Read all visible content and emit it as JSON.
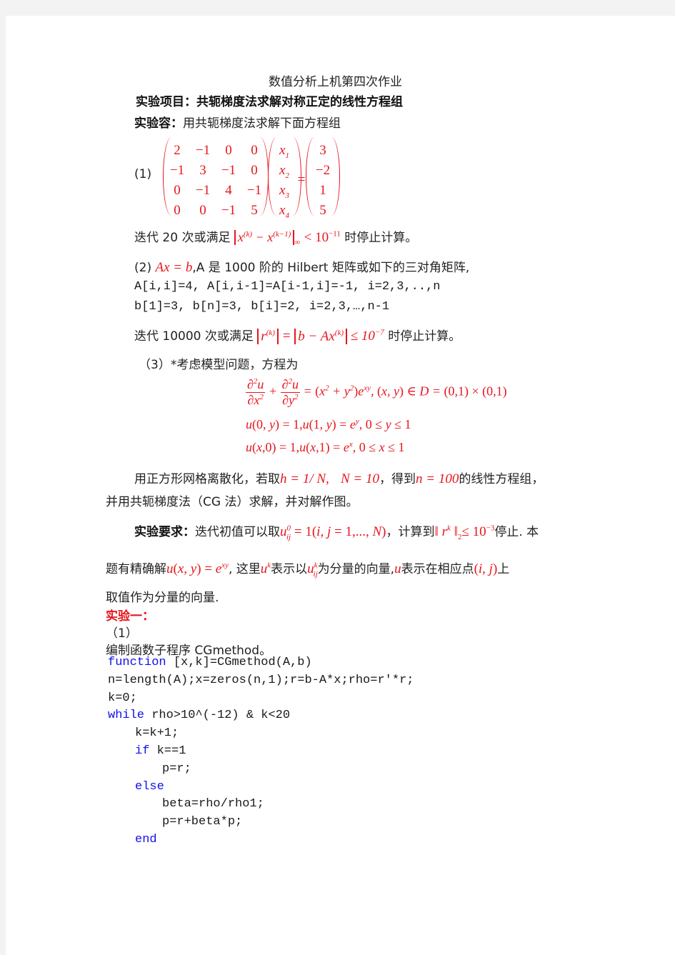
{
  "title": "数值分析上机第四次作业",
  "project": {
    "label": "实验项目：",
    "text": "共轭梯度法求解对称正定的线性方程组"
  },
  "content": {
    "label": "实验容：",
    "text": "用共轭梯度法求解下面方程组"
  },
  "problem1": {
    "label": "(1)",
    "matrix": [
      [
        "2",
        "−1",
        "0",
        "0"
      ],
      [
        "−1",
        "3",
        "−1",
        "0"
      ],
      [
        "0",
        "−1",
        "4",
        "−1"
      ],
      [
        "0",
        "0",
        "−1",
        "5"
      ]
    ],
    "x_vector": [
      "x1",
      "x2",
      "x3",
      "x4"
    ],
    "rhs": [
      "3",
      "−2",
      "1",
      "5"
    ],
    "equals": "=",
    "stop_prefix": "迭代 20 次或满足",
    "stop_norm": "x(k) − x(k−1)",
    "stop_norm_sub": "∞",
    "stop_cond": "< 10",
    "stop_exp": "−11",
    "stop_suffix": "时停止计算。"
  },
  "problem2": {
    "label": "(2)",
    "eq": "Ax = b",
    "desc": ",A 是 1000 阶的 Hilbert 矩阵或如下的三对角矩阵,",
    "line_a": "A[i,i]=4, A[i,i-1]=A[i-1,i]=-1, i=2,3,..,n",
    "line_b": "b[1]=3, b[n]=3, b[i]=2, i=2,3,…,n-1",
    "stop_prefix": "迭代 10000 次或满足",
    "stop_math": "‖r(k)‖ = ‖b − Ax(k)‖ ≤ 10",
    "stop_exp": "−7",
    "stop_suffix": "时停止计算。"
  },
  "problem3": {
    "label": "（3）*考虑模型问题，方程为",
    "pde": "∂²u/∂x² + ∂²u/∂y² = (x² + y²)e^xy , (x, y) ∈ D = (0,1) × (0,1)",
    "bc1": "u(0, y) = 1, u(1, y) = e^y , 0 ≤ y ≤ 1",
    "bc2": "u(x,0) = 1, u(x,1) = e^x , 0 ≤ x ≤ 1",
    "para1_a": "用正方形网格离散化，若取",
    "para1_h": "h = 1/ N,",
    "para1_N": "N = 10",
    "para1_b": "，得到",
    "para1_n": "n = 100",
    "para1_c": "的线性方程组，",
    "para2": "并用共轭梯度法（CG 法）求解，并对解作图。"
  },
  "requirements": {
    "label": "实验要求：",
    "t1": "迭代初值可以取",
    "m1": "u_ij^0 = 1(i, j = 1,..., N)",
    "t2": "，计算到",
    "m2": "‖ r^k ‖₂ ≤ 10^−3",
    "t3": "停止. 本",
    "t4": "题有精确解",
    "m3": "u(x, y) = e^xy",
    "t5": ", 这里",
    "m4": "u^k",
    "t6": "表示以",
    "m5": "u_ij^k",
    "t7": "为分量的向量,",
    "m6": "u",
    "t8": "表示在相应点",
    "m7": "(i, j)",
    "t9": "上",
    "t10": "取值作为分量的向量."
  },
  "experiment1": {
    "heading": "实验一：",
    "sub": "（1）",
    "desc": "编制函数子程序 CGmethod。"
  },
  "code": [
    {
      "kw": "function",
      "text": " [x,k]=CGmethod(A,b)",
      "indent": 0
    },
    {
      "kw": "",
      "text": "n=length(A);x=zeros(n,1);r=b-A*x;rho=r'*r;",
      "indent": 0
    },
    {
      "kw": "",
      "text": "k=0;",
      "indent": 0
    },
    {
      "kw": "while",
      "text": " rho>10^(-12) & k<20",
      "indent": 0
    },
    {
      "kw": "",
      "text": "k=k+1;",
      "indent": 1
    },
    {
      "kw": "if",
      "text": " k==1",
      "indent": 1
    },
    {
      "kw": "",
      "text": "p=r;",
      "indent": 2
    },
    {
      "kw": "else",
      "text": "",
      "indent": 1
    },
    {
      "kw": "",
      "text": "beta=rho/rho1;",
      "indent": 2
    },
    {
      "kw": "",
      "text": "p=r+beta*p;",
      "indent": 2
    },
    {
      "kw": "end",
      "text": "",
      "indent": 1
    }
  ]
}
